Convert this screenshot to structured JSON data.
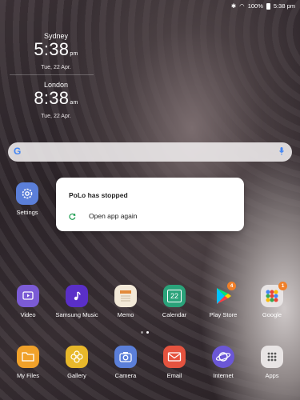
{
  "status_bar": {
    "battery": "100%",
    "time": "5:38 pm"
  },
  "clocks": [
    {
      "city": "Sydney",
      "time": "5:38",
      "ampm": "pm",
      "date": "Tue, 22 Apr."
    },
    {
      "city": "London",
      "time": "8:38",
      "ampm": "am",
      "date": "Tue, 22 Apr."
    }
  ],
  "search": {
    "logo": "G"
  },
  "dialog": {
    "title": "PoLo has stopped",
    "action_label": "Open app again"
  },
  "settings_app": {
    "label": "Settings"
  },
  "apps_row1": [
    {
      "label": "Video"
    },
    {
      "label": "Samsung Music"
    },
    {
      "label": "Memo"
    },
    {
      "label": "Calendar",
      "day": "22"
    },
    {
      "label": "Play Store",
      "badge": "4"
    },
    {
      "label": "Google",
      "badge": "1"
    }
  ],
  "apps_row2": [
    {
      "label": "My Files"
    },
    {
      "label": "Gallery"
    },
    {
      "label": "Camera"
    },
    {
      "label": "Email"
    },
    {
      "label": "Internet"
    },
    {
      "label": "Apps"
    }
  ]
}
